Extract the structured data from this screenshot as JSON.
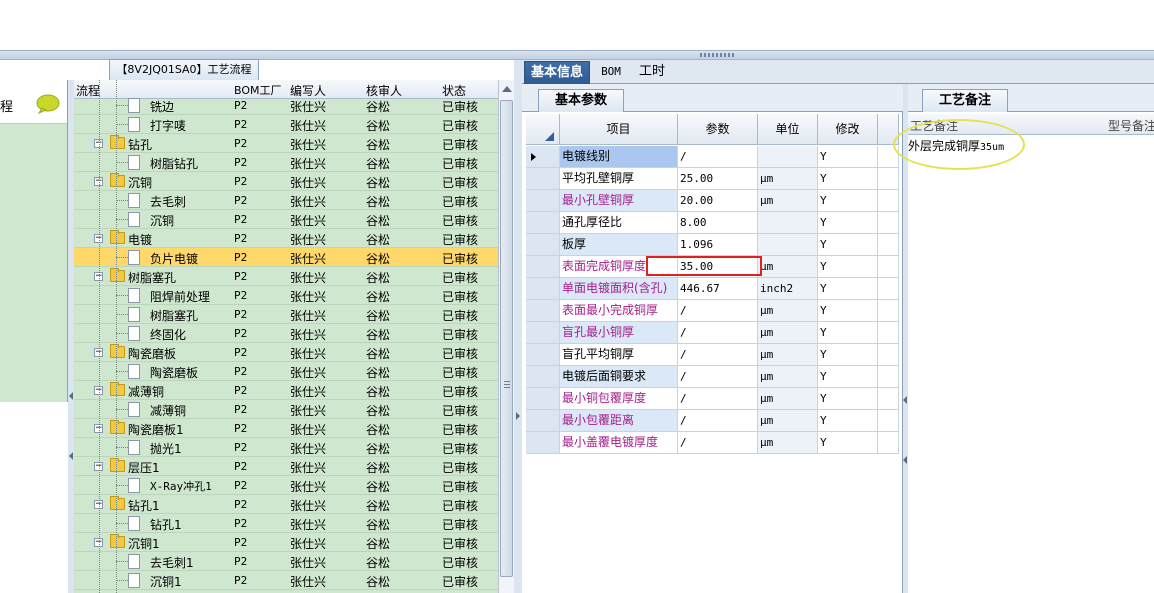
{
  "flow_title": "【8V2JQ01SA0】工艺流程",
  "left_pane": {
    "title": "程"
  },
  "tree": {
    "columns": [
      "流程",
      "BOM工厂",
      "编写人",
      "核审人",
      "状态"
    ],
    "rows": [
      {
        "level": 2,
        "type": "doc",
        "name": "铣边",
        "bom": "P2",
        "writer": "张仕兴",
        "reviewer": "谷松",
        "status": "已审核"
      },
      {
        "level": 2,
        "type": "doc",
        "name": "打字唛",
        "bom": "P2",
        "writer": "张仕兴",
        "reviewer": "谷松",
        "status": "已审核"
      },
      {
        "level": 1,
        "type": "folder",
        "name": "钻孔",
        "bom": "P2",
        "writer": "张仕兴",
        "reviewer": "谷松",
        "status": "已审核"
      },
      {
        "level": 2,
        "type": "doc",
        "name": "树脂钻孔",
        "bom": "P2",
        "writer": "张仕兴",
        "reviewer": "谷松",
        "status": "已审核"
      },
      {
        "level": 1,
        "type": "folder",
        "name": "沉铜",
        "bom": "P2",
        "writer": "张仕兴",
        "reviewer": "谷松",
        "status": "已审核"
      },
      {
        "level": 2,
        "type": "doc",
        "name": "去毛刺",
        "bom": "P2",
        "writer": "张仕兴",
        "reviewer": "谷松",
        "status": "已审核"
      },
      {
        "level": 2,
        "type": "doc",
        "name": "沉铜",
        "bom": "P2",
        "writer": "张仕兴",
        "reviewer": "谷松",
        "status": "已审核"
      },
      {
        "level": 1,
        "type": "folder",
        "name": "电镀",
        "bom": "P2",
        "writer": "张仕兴",
        "reviewer": "谷松",
        "status": "已审核"
      },
      {
        "level": 2,
        "type": "doc",
        "name": "负片电镀",
        "bom": "P2",
        "writer": "张仕兴",
        "reviewer": "谷松",
        "status": "已审核",
        "selected": true
      },
      {
        "level": 1,
        "type": "folder",
        "name": "树脂塞孔",
        "bom": "P2",
        "writer": "张仕兴",
        "reviewer": "谷松",
        "status": "已审核"
      },
      {
        "level": 2,
        "type": "doc",
        "name": "阻焊前处理",
        "bom": "P2",
        "writer": "张仕兴",
        "reviewer": "谷松",
        "status": "已审核"
      },
      {
        "level": 2,
        "type": "doc",
        "name": "树脂塞孔",
        "bom": "P2",
        "writer": "张仕兴",
        "reviewer": "谷松",
        "status": "已审核"
      },
      {
        "level": 2,
        "type": "doc",
        "name": "终固化",
        "bom": "P2",
        "writer": "张仕兴",
        "reviewer": "谷松",
        "status": "已审核"
      },
      {
        "level": 1,
        "type": "folder",
        "name": "陶瓷磨板",
        "bom": "P2",
        "writer": "张仕兴",
        "reviewer": "谷松",
        "status": "已审核"
      },
      {
        "level": 2,
        "type": "doc",
        "name": "陶瓷磨板",
        "bom": "P2",
        "writer": "张仕兴",
        "reviewer": "谷松",
        "status": "已审核"
      },
      {
        "level": 1,
        "type": "folder",
        "name": "减薄铜",
        "bom": "P2",
        "writer": "张仕兴",
        "reviewer": "谷松",
        "status": "已审核"
      },
      {
        "level": 2,
        "type": "doc",
        "name": "减薄铜",
        "bom": "P2",
        "writer": "张仕兴",
        "reviewer": "谷松",
        "status": "已审核"
      },
      {
        "level": 1,
        "type": "folder",
        "name": "陶瓷磨板1",
        "bom": "P2",
        "writer": "张仕兴",
        "reviewer": "谷松",
        "status": "已审核"
      },
      {
        "level": 2,
        "type": "doc",
        "name": "抛光1",
        "bom": "P2",
        "writer": "张仕兴",
        "reviewer": "谷松",
        "status": "已审核"
      },
      {
        "level": 1,
        "type": "folder",
        "name": "层压1",
        "bom": "P2",
        "writer": "张仕兴",
        "reviewer": "谷松",
        "status": "已审核"
      },
      {
        "level": 2,
        "type": "doc",
        "name": "X-Ray冲孔1",
        "bom": "P2",
        "writer": "张仕兴",
        "reviewer": "谷松",
        "status": "已审核"
      },
      {
        "level": 1,
        "type": "folder",
        "name": "钻孔1",
        "bom": "P2",
        "writer": "张仕兴",
        "reviewer": "谷松",
        "status": "已审核"
      },
      {
        "level": 2,
        "type": "doc",
        "name": "钻孔1",
        "bom": "P2",
        "writer": "张仕兴",
        "reviewer": "谷松",
        "status": "已审核"
      },
      {
        "level": 1,
        "type": "folder",
        "name": "沉铜1",
        "bom": "P2",
        "writer": "张仕兴",
        "reviewer": "谷松",
        "status": "已审核"
      },
      {
        "level": 2,
        "type": "doc",
        "name": "去毛刺1",
        "bom": "P2",
        "writer": "张仕兴",
        "reviewer": "谷松",
        "status": "已审核"
      },
      {
        "level": 2,
        "type": "doc",
        "name": "沉铜1",
        "bom": "P2",
        "writer": "张仕兴",
        "reviewer": "谷松",
        "status": "已审核"
      }
    ]
  },
  "main_tabs": [
    {
      "label": "基本信息",
      "active": true
    },
    {
      "label": "BOM",
      "active": false
    },
    {
      "label": "工时",
      "active": false
    }
  ],
  "param_panel": {
    "tab": "基本参数",
    "columns": [
      "项目",
      "参数",
      "单位",
      "修改"
    ],
    "rows": [
      {
        "name": "电镀线别",
        "value": "/",
        "unit": "",
        "modify": "Y",
        "style": "sel",
        "current": true
      },
      {
        "name": "平均孔壁铜厚",
        "value": "25.00",
        "unit": "μm",
        "modify": "Y",
        "style": "normal"
      },
      {
        "name": "最小孔壁铜厚",
        "value": "20.00",
        "unit": "μm",
        "modify": "Y",
        "style": "purple"
      },
      {
        "name": "通孔厚径比",
        "value": "8.00",
        "unit": "",
        "modify": "Y",
        "style": "normal"
      },
      {
        "name": "板厚",
        "value": "1.096",
        "unit": "",
        "modify": "Y",
        "style": "normal"
      },
      {
        "name": "表面完成铜厚度",
        "value": "35.00",
        "unit": "μm",
        "modify": "Y",
        "style": "purple"
      },
      {
        "name": "单面电镀面积(含孔)",
        "value": "446.67",
        "unit": "inch2",
        "modify": "Y",
        "style": "purple"
      },
      {
        "name": "表面最小完成铜厚",
        "value": "/",
        "unit": "μm",
        "modify": "Y",
        "style": "purple"
      },
      {
        "name": "盲孔最小铜厚",
        "value": "/",
        "unit": "μm",
        "modify": "Y",
        "style": "purple"
      },
      {
        "name": "盲孔平均铜厚",
        "value": "/",
        "unit": "μm",
        "modify": "Y",
        "style": "normal"
      },
      {
        "name": "电镀后面铜要求",
        "value": "/",
        "unit": "μm",
        "modify": "Y",
        "style": "normal"
      },
      {
        "name": "最小铜包覆厚度",
        "value": "/",
        "unit": "μm",
        "modify": "Y",
        "style": "purple"
      },
      {
        "name": "最小包覆距离",
        "value": "/",
        "unit": "μm",
        "modify": "Y",
        "style": "purple"
      },
      {
        "name": "最小盖覆电镀厚度",
        "value": "/",
        "unit": "μm",
        "modify": "Y",
        "style": "purple"
      }
    ]
  },
  "note_panel": {
    "tab": "工艺备注",
    "columns": [
      "工艺备注",
      "型号备注"
    ],
    "note_text": "外层完成铜厚",
    "note_value": "35um"
  },
  "colors": {
    "accent": "#2f5a92",
    "tree_bg": "#cfe7cf",
    "selected_row": "#ffd86b",
    "highlight_box": "#e02020",
    "annotation_ellipse": "#e4e252",
    "purple_text": "#a4208a"
  }
}
